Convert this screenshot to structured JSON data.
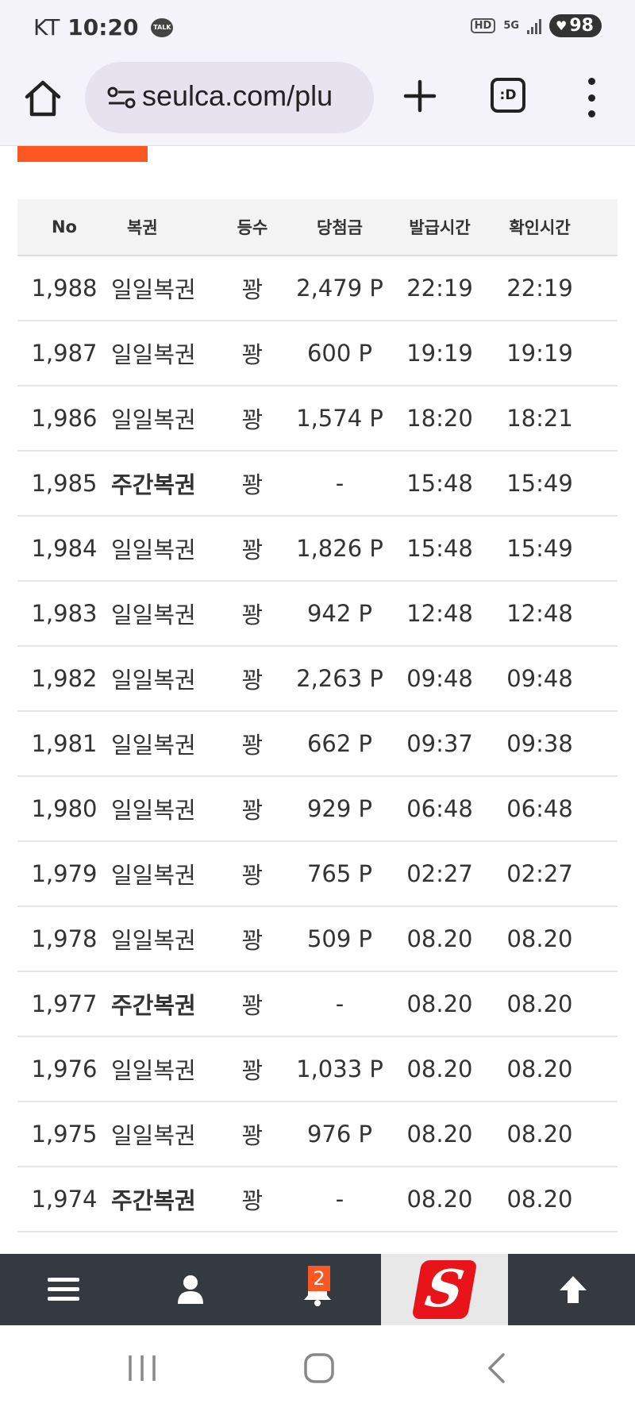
{
  "status_bar": {
    "carrier": "KT",
    "time": "10:20",
    "talk_icon_label": "TALK",
    "hd_label": "HD",
    "network_label": "5G",
    "battery": "98"
  },
  "browser": {
    "url": "seulca.com/plu",
    "tabs_label": ":D"
  },
  "table": {
    "headers": {
      "no": "No",
      "type": "복권",
      "rank": "등수",
      "prize": "당첨금",
      "issued": "발급시간",
      "checked": "확인시간"
    },
    "rows": [
      {
        "no": "1,988",
        "type": "일일복권",
        "rank": "꽝",
        "prize": "2,479 P",
        "issued": "22:19",
        "checked": "22:19"
      },
      {
        "no": "1,987",
        "type": "일일복권",
        "rank": "꽝",
        "prize": "600 P",
        "issued": "19:19",
        "checked": "19:19"
      },
      {
        "no": "1,986",
        "type": "일일복권",
        "rank": "꽝",
        "prize": "1,574 P",
        "issued": "18:20",
        "checked": "18:21"
      },
      {
        "no": "1,985",
        "type": "주간복권",
        "rank": "꽝",
        "prize": "-",
        "issued": "15:48",
        "checked": "15:49"
      },
      {
        "no": "1,984",
        "type": "일일복권",
        "rank": "꽝",
        "prize": "1,826 P",
        "issued": "15:48",
        "checked": "15:49"
      },
      {
        "no": "1,983",
        "type": "일일복권",
        "rank": "꽝",
        "prize": "942 P",
        "issued": "12:48",
        "checked": "12:48"
      },
      {
        "no": "1,982",
        "type": "일일복권",
        "rank": "꽝",
        "prize": "2,263 P",
        "issued": "09:48",
        "checked": "09:48"
      },
      {
        "no": "1,981",
        "type": "일일복권",
        "rank": "꽝",
        "prize": "662 P",
        "issued": "09:37",
        "checked": "09:38"
      },
      {
        "no": "1,980",
        "type": "일일복권",
        "rank": "꽝",
        "prize": "929 P",
        "issued": "06:48",
        "checked": "06:48"
      },
      {
        "no": "1,979",
        "type": "일일복권",
        "rank": "꽝",
        "prize": "765 P",
        "issued": "02:27",
        "checked": "02:27"
      },
      {
        "no": "1,978",
        "type": "일일복권",
        "rank": "꽝",
        "prize": "509 P",
        "issued": "08.20",
        "checked": "08.20"
      },
      {
        "no": "1,977",
        "type": "주간복권",
        "rank": "꽝",
        "prize": "-",
        "issued": "08.20",
        "checked": "08.20"
      },
      {
        "no": "1,976",
        "type": "일일복권",
        "rank": "꽝",
        "prize": "1,033 P",
        "issued": "08.20",
        "checked": "08.20"
      },
      {
        "no": "1,975",
        "type": "일일복권",
        "rank": "꽝",
        "prize": "976 P",
        "issued": "08.20",
        "checked": "08.20"
      },
      {
        "no": "1,974",
        "type": "주간복권",
        "rank": "꽝",
        "prize": "-",
        "issued": "08.20",
        "checked": "08.20"
      }
    ],
    "bold_type": "주간복권"
  },
  "bottom_nav": {
    "items": [
      "menu-icon",
      "user-icon",
      "bell-icon",
      "site-logo",
      "arrow-up-icon"
    ],
    "notification_count": "2",
    "logo_letter": "S"
  },
  "colors": {
    "accent": "#ff5722",
    "nav_bg": "#343a40",
    "logo_red": "#e8141a"
  },
  "system_nav": {
    "items": [
      "recent-apps-icon",
      "home-icon",
      "back-icon"
    ]
  }
}
